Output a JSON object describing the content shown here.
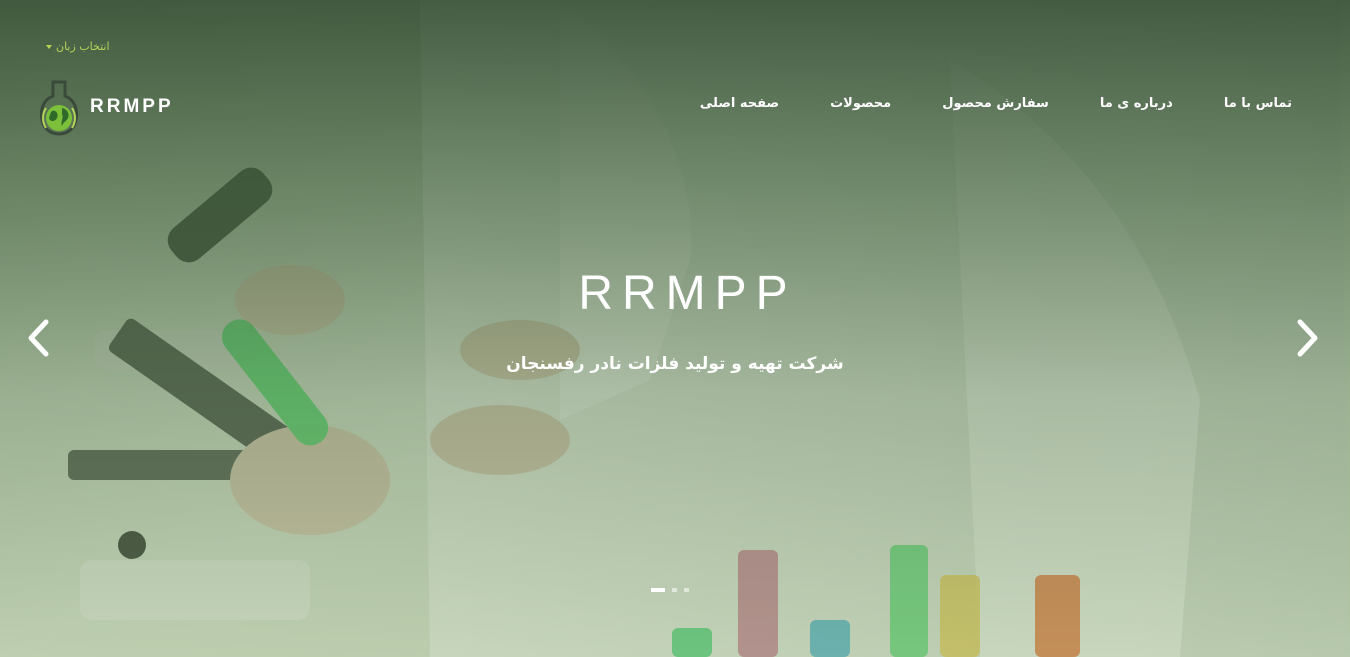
{
  "language_selector": {
    "label": "انتخاب زبان"
  },
  "brand": {
    "name": "RRMPP",
    "logo_icon": "flask-globe-icon"
  },
  "nav": {
    "items": [
      {
        "label": "صفحه اصلی"
      },
      {
        "label": "محصولات"
      },
      {
        "label": "سفارش محصول"
      },
      {
        "label": "درباره ی ما"
      },
      {
        "label": "تماس با ما"
      }
    ]
  },
  "hero": {
    "title": "RRMPP",
    "subtitle": "شرکت تهیه و تولید فلزات نادر رفسنجان",
    "prev_icon": "chevron-left-icon",
    "next_icon": "chevron-right-icon",
    "slide_count": 3,
    "active_slide": 1
  },
  "colors": {
    "overlay": "#3e5e39",
    "accent": "#b6d35a",
    "text": "#ffffff"
  }
}
